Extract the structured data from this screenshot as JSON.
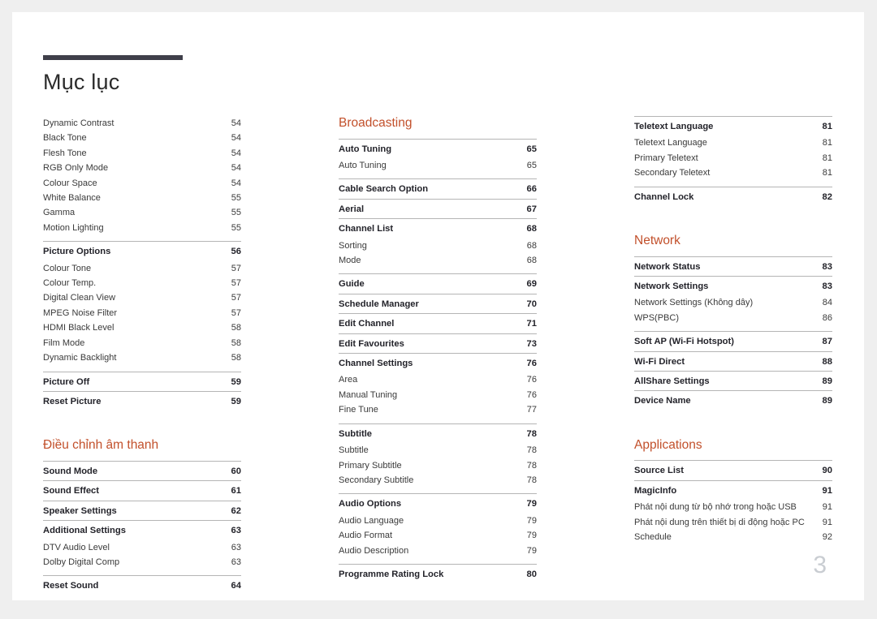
{
  "document": {
    "title": "Mục lục",
    "page_number": "3",
    "accent_color": "#c2502b",
    "rule_color": "#3f3f4a"
  },
  "columns": [
    {
      "name": "column-1",
      "blocks": [
        {
          "type": "group",
          "rule": false,
          "items": [
            {
              "level": "minor",
              "label": "Dynamic Contrast",
              "page": "54"
            },
            {
              "level": "minor",
              "label": "Black Tone",
              "page": "54"
            },
            {
              "level": "minor",
              "label": "Flesh Tone",
              "page": "54"
            },
            {
              "level": "minor",
              "label": "RGB Only Mode",
              "page": "54"
            },
            {
              "level": "minor",
              "label": "Colour Space",
              "page": "54"
            },
            {
              "level": "minor",
              "label": "White Balance",
              "page": "55"
            },
            {
              "level": "minor",
              "label": "Gamma",
              "page": "55"
            },
            {
              "level": "minor",
              "label": "Motion Lighting",
              "page": "55"
            }
          ]
        },
        {
          "type": "group",
          "rule": true,
          "items": [
            {
              "level": "major",
              "label": "Picture Options",
              "page": "56"
            },
            {
              "level": "minor",
              "label": "Colour Tone",
              "page": "57"
            },
            {
              "level": "minor",
              "label": "Colour Temp.",
              "page": "57"
            },
            {
              "level": "minor",
              "label": "Digital Clean View",
              "page": "57"
            },
            {
              "level": "minor",
              "label": "MPEG Noise Filter",
              "page": "57"
            },
            {
              "level": "minor",
              "label": "HDMI Black Level",
              "page": "58"
            },
            {
              "level": "minor",
              "label": "Film Mode",
              "page": "58"
            },
            {
              "level": "minor",
              "label": "Dynamic Backlight",
              "page": "58"
            }
          ]
        },
        {
          "type": "group",
          "rule": true,
          "items": [
            {
              "level": "major",
              "label": "Picture Off",
              "page": "59"
            }
          ]
        },
        {
          "type": "group",
          "rule": true,
          "items": [
            {
              "level": "major",
              "label": "Reset Picture",
              "page": "59"
            }
          ]
        },
        {
          "type": "heading",
          "label": "Điều chỉnh âm thanh",
          "spaced": true
        },
        {
          "type": "group",
          "rule": true,
          "items": [
            {
              "level": "major",
              "label": "Sound Mode",
              "page": "60"
            }
          ]
        },
        {
          "type": "group",
          "rule": true,
          "items": [
            {
              "level": "major",
              "label": "Sound Effect",
              "page": "61"
            }
          ]
        },
        {
          "type": "group",
          "rule": true,
          "items": [
            {
              "level": "major",
              "label": "Speaker Settings",
              "page": "62"
            }
          ]
        },
        {
          "type": "group",
          "rule": true,
          "items": [
            {
              "level": "major",
              "label": "Additional Settings",
              "page": "63"
            },
            {
              "level": "minor",
              "label": "DTV Audio Level",
              "page": "63"
            },
            {
              "level": "minor",
              "label": "Dolby Digital Comp",
              "page": "63"
            }
          ]
        },
        {
          "type": "group",
          "rule": true,
          "items": [
            {
              "level": "major",
              "label": "Reset Sound",
              "page": "64"
            }
          ]
        }
      ]
    },
    {
      "name": "column-2",
      "blocks": [
        {
          "type": "heading",
          "label": "Broadcasting",
          "spaced": false
        },
        {
          "type": "group",
          "rule": true,
          "items": [
            {
              "level": "major",
              "label": "Auto Tuning",
              "page": "65"
            },
            {
              "level": "minor",
              "label": "Auto Tuning",
              "page": "65"
            }
          ]
        },
        {
          "type": "group",
          "rule": true,
          "items": [
            {
              "level": "major",
              "label": "Cable Search Option",
              "page": "66"
            }
          ]
        },
        {
          "type": "group",
          "rule": true,
          "items": [
            {
              "level": "major",
              "label": "Aerial",
              "page": "67"
            }
          ]
        },
        {
          "type": "group",
          "rule": true,
          "items": [
            {
              "level": "major",
              "label": "Channel List",
              "page": "68"
            },
            {
              "level": "minor",
              "label": "Sorting",
              "page": "68"
            },
            {
              "level": "minor",
              "label": "Mode",
              "page": "68"
            }
          ]
        },
        {
          "type": "group",
          "rule": true,
          "items": [
            {
              "level": "major",
              "label": "Guide",
              "page": "69"
            }
          ]
        },
        {
          "type": "group",
          "rule": true,
          "items": [
            {
              "level": "major",
              "label": "Schedule Manager",
              "page": "70"
            }
          ]
        },
        {
          "type": "group",
          "rule": true,
          "items": [
            {
              "level": "major",
              "label": "Edit Channel",
              "page": "71"
            }
          ]
        },
        {
          "type": "group",
          "rule": true,
          "items": [
            {
              "level": "major",
              "label": "Edit Favourites",
              "page": "73"
            }
          ]
        },
        {
          "type": "group",
          "rule": true,
          "items": [
            {
              "level": "major",
              "label": "Channel Settings",
              "page": "76"
            },
            {
              "level": "minor",
              "label": "Area",
              "page": "76"
            },
            {
              "level": "minor",
              "label": "Manual Tuning",
              "page": "76"
            },
            {
              "level": "minor",
              "label": "Fine Tune",
              "page": "77"
            }
          ]
        },
        {
          "type": "group",
          "rule": true,
          "items": [
            {
              "level": "major",
              "label": "Subtitle",
              "page": "78"
            },
            {
              "level": "minor",
              "label": "Subtitle",
              "page": "78"
            },
            {
              "level": "minor",
              "label": "Primary Subtitle",
              "page": "78"
            },
            {
              "level": "minor",
              "label": "Secondary Subtitle",
              "page": "78"
            }
          ]
        },
        {
          "type": "group",
          "rule": true,
          "items": [
            {
              "level": "major",
              "label": "Audio Options",
              "page": "79"
            },
            {
              "level": "minor",
              "label": "Audio Language",
              "page": "79"
            },
            {
              "level": "minor",
              "label": "Audio Format",
              "page": "79"
            },
            {
              "level": "minor",
              "label": "Audio Description",
              "page": "79"
            }
          ]
        },
        {
          "type": "group",
          "rule": true,
          "items": [
            {
              "level": "major",
              "label": "Programme Rating Lock",
              "page": "80"
            }
          ]
        }
      ]
    },
    {
      "name": "column-3",
      "blocks": [
        {
          "type": "group",
          "rule": true,
          "items": [
            {
              "level": "major",
              "label": "Teletext Language",
              "page": "81"
            },
            {
              "level": "minor",
              "label": "Teletext Language",
              "page": "81"
            },
            {
              "level": "minor",
              "label": "Primary Teletext",
              "page": "81"
            },
            {
              "level": "minor",
              "label": "Secondary Teletext",
              "page": "81"
            }
          ]
        },
        {
          "type": "group",
          "rule": true,
          "items": [
            {
              "level": "major",
              "label": "Channel Lock",
              "page": "82"
            }
          ]
        },
        {
          "type": "heading",
          "label": "Network",
          "spaced": true
        },
        {
          "type": "group",
          "rule": true,
          "items": [
            {
              "level": "major",
              "label": "Network Status",
              "page": "83"
            }
          ]
        },
        {
          "type": "group",
          "rule": true,
          "items": [
            {
              "level": "major",
              "label": "Network Settings",
              "page": "83"
            },
            {
              "level": "minor",
              "label": "Network Settings (Không dây)",
              "page": "84"
            },
            {
              "level": "minor",
              "label": "WPS(PBC)",
              "page": "86"
            }
          ]
        },
        {
          "type": "group",
          "rule": true,
          "items": [
            {
              "level": "major",
              "label": "Soft AP (Wi-Fi Hotspot)",
              "page": "87"
            }
          ]
        },
        {
          "type": "group",
          "rule": true,
          "items": [
            {
              "level": "major",
              "label": "Wi-Fi Direct",
              "page": "88"
            }
          ]
        },
        {
          "type": "group",
          "rule": true,
          "items": [
            {
              "level": "major",
              "label": "AllShare Settings",
              "page": "89"
            }
          ]
        },
        {
          "type": "group",
          "rule": true,
          "items": [
            {
              "level": "major",
              "label": "Device Name",
              "page": "89"
            }
          ]
        },
        {
          "type": "heading",
          "label": "Applications",
          "spaced": true
        },
        {
          "type": "group",
          "rule": true,
          "items": [
            {
              "level": "major",
              "label": "Source List",
              "page": "90"
            }
          ]
        },
        {
          "type": "group",
          "rule": true,
          "items": [
            {
              "level": "major",
              "label": "MagicInfo",
              "page": "91"
            },
            {
              "level": "minor",
              "label": "Phát nội dung từ bộ nhớ trong hoặc USB",
              "page": "91"
            },
            {
              "level": "minor",
              "label": "Phát nội dung trên thiết bị di động hoặc PC",
              "page": "91"
            },
            {
              "level": "minor",
              "label": "Schedule",
              "page": "92"
            }
          ]
        }
      ]
    }
  ]
}
